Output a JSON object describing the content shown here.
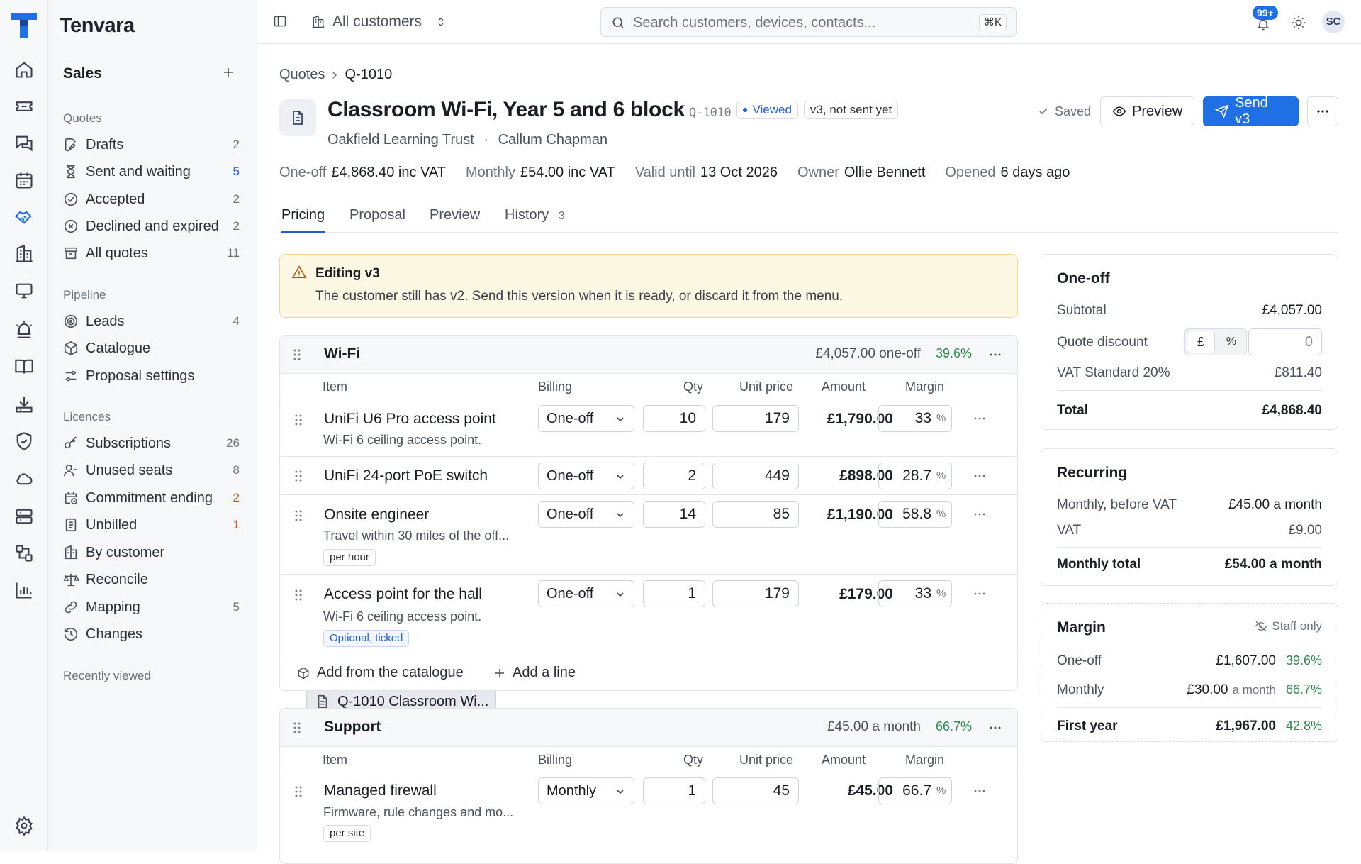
{
  "app": {
    "name": "Tenvara"
  },
  "sidebar": {
    "section": "Sales",
    "groups": {
      "quotes": "Quotes",
      "pipeline": "Pipeline",
      "licences": "Licences",
      "recent": "Recently viewed"
    },
    "quotes": [
      {
        "label": "Drafts",
        "count": "2"
      },
      {
        "label": "Sent and waiting",
        "count": "5"
      },
      {
        "label": "Accepted",
        "count": "2"
      },
      {
        "label": "Declined and expired",
        "count": "2"
      },
      {
        "label": "All quotes",
        "count": "11"
      }
    ],
    "pipeline": [
      {
        "label": "Leads",
        "count": "4"
      },
      {
        "label": "Catalogue",
        "count": ""
      },
      {
        "label": "Proposal settings",
        "count": ""
      }
    ],
    "licences": [
      {
        "label": "Subscriptions",
        "count": "26"
      },
      {
        "label": "Unused seats",
        "count": "8"
      },
      {
        "label": "Commitment ending",
        "count": "2"
      },
      {
        "label": "Unbilled",
        "count": "1"
      },
      {
        "label": "By customer",
        "count": ""
      },
      {
        "label": "Reconcile",
        "count": ""
      },
      {
        "label": "Mapping",
        "count": "5"
      },
      {
        "label": "Changes",
        "count": ""
      }
    ],
    "recent": [
      {
        "label": "Q-1010 Classroom Wi..."
      }
    ]
  },
  "topbar": {
    "scope": "All customers",
    "search_placeholder": "Search customers, devices, contacts...",
    "search_shortcut": "⌘K",
    "notif_badge": "99+",
    "avatar": "SC"
  },
  "breadcrumb": {
    "root": "Quotes",
    "current": "Q-1010"
  },
  "quote": {
    "title": "Classroom Wi-Fi, Year 5 and 6 block",
    "id": "Q-1010",
    "status": "Viewed",
    "version_badge": "v3, not sent yet",
    "customer": "Oakfield Learning Trust",
    "contact": "Callum Chapman",
    "saved": "Saved",
    "preview_btn": "Preview",
    "send_btn": "Send v3"
  },
  "stats": [
    {
      "k": "One-off",
      "v": "£4,868.40 inc VAT"
    },
    {
      "k": "Monthly",
      "v": "£54.00 inc VAT"
    },
    {
      "k": "Valid until",
      "v": "13 Oct 2026"
    },
    {
      "k": "Owner",
      "v": "Ollie Bennett"
    },
    {
      "k": "Opened",
      "v": "6 days ago"
    }
  ],
  "tabs": [
    {
      "label": "Pricing"
    },
    {
      "label": "Proposal"
    },
    {
      "label": "Preview"
    },
    {
      "label": "History",
      "count": "3"
    }
  ],
  "warning": {
    "title": "Editing v3",
    "text": "The customer still has v2. Send this version when it is ready, or discard it from the menu."
  },
  "columns": {
    "item": "Item",
    "billing": "Billing",
    "qty": "Qty",
    "unit": "Unit price",
    "amount": "Amount",
    "margin": "Margin"
  },
  "wifi": {
    "name": "Wi-Fi",
    "total": "£4,057.00 one-off",
    "margin": "39.6%",
    "add_catalogue": "Add from the catalogue",
    "add_line": "Add a line",
    "rows": [
      {
        "name": "UniFi U6 Pro access point",
        "desc": "Wi-Fi 6 ceiling access point.",
        "billing": "One-off",
        "qty": "10",
        "unit": "179",
        "amount": "£1,790.00",
        "margin": "33"
      },
      {
        "name": "UniFi 24-port PoE switch",
        "billing": "One-off",
        "qty": "2",
        "unit": "449",
        "amount": "£898.00",
        "margin": "28.7"
      },
      {
        "name": "Onsite engineer",
        "desc": "Travel within 30 miles of the off...",
        "tag": "per hour",
        "billing": "One-off",
        "qty": "14",
        "unit": "85",
        "amount": "£1,190.00",
        "margin": "58.8"
      },
      {
        "name": "Access point for the hall",
        "desc": "Wi-Fi 6 ceiling access point.",
        "tag": "Optional, ticked",
        "billing": "One-off",
        "qty": "1",
        "unit": "179",
        "amount": "£179.00",
        "margin": "33"
      }
    ]
  },
  "support": {
    "name": "Support",
    "total": "£45.00 a month",
    "margin": "66.7%",
    "rows": [
      {
        "name": "Managed firewall",
        "desc": "Firmware, rule changes and mo...",
        "tag": "per site",
        "billing": "Monthly",
        "qty": "1",
        "unit": "45",
        "amount": "£45.00",
        "margin": "66.7"
      }
    ]
  },
  "oneoff": {
    "title": "One-off",
    "subtotal_l": "Subtotal",
    "subtotal": "£4,057.00",
    "discount_l": "Quote discount",
    "discount": "0",
    "cur": "£",
    "pct": "%",
    "vat_l": "VAT Standard 20%",
    "vat": "£811.40",
    "total_l": "Total",
    "total": "£4,868.40"
  },
  "recurring": {
    "title": "Recurring",
    "before_l": "Monthly, before VAT",
    "before": "£45.00 a month",
    "vat_l": "VAT",
    "vat": "£9.00",
    "total_l": "Monthly total",
    "total": "£54.00 a month"
  },
  "margin_panel": {
    "title": "Margin",
    "staff": "Staff only",
    "oneoff_l": "One-off",
    "oneoff": "£1,607.00",
    "oneoff_p": "39.6%",
    "monthly_l": "Monthly",
    "monthly": "£30.00",
    "monthly_suffix": "a month",
    "monthly_p": "66.7%",
    "year_l": "First year",
    "year": "£1,967.00",
    "year_p": "42.8%"
  },
  "colors": {
    "accent": "#1f6fe5",
    "warning_bg": "#fdf8e3",
    "margin_green": "#2e8a4d",
    "count_orange": "#d4591a"
  }
}
